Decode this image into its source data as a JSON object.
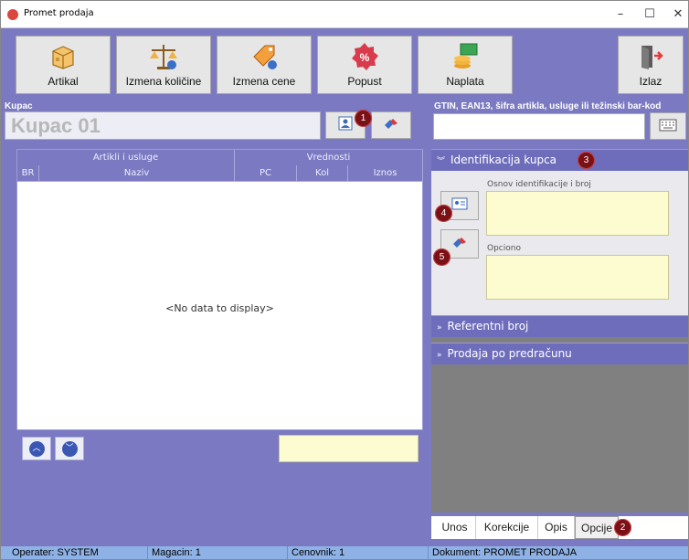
{
  "window": {
    "title": "Promet prodaja",
    "minimize": "–",
    "maximize": "☐",
    "close": "✕"
  },
  "toolbar": {
    "artikal": "Artikal",
    "izmena_kolicine": "Izmena količine",
    "izmena_cene": "Izmena cene",
    "popust": "Popust",
    "naplata": "Naplata",
    "izlaz": "Izlaz"
  },
  "kupac": {
    "label": "Kupac",
    "value": "Kupac 01"
  },
  "gtin": {
    "label": "GTIN, EAN13, šifra artikla, usluge ili težinski bar-kod",
    "value": ""
  },
  "grid": {
    "group_headers": [
      "Artikli i usluge",
      "Vrednosti"
    ],
    "columns": [
      "BR",
      "Naziv",
      "PC",
      "Kol",
      "Iznos"
    ],
    "empty_text": "<No data to display>"
  },
  "panel": {
    "identifikacija": "Identifikacija kupca",
    "osnov_label": "Osnov identifikacije i broj",
    "opciono_label": "Opciono",
    "referentni": "Referentni broj",
    "predracun": "Prodaja po predračunu"
  },
  "tabs": [
    "Unos",
    "Korekcije",
    "Opis",
    "Opcije"
  ],
  "badges": [
    "1",
    "2",
    "3",
    "4",
    "5"
  ],
  "status": {
    "operater": "Operater: SYSTEM",
    "magacin": "Magacin: 1",
    "cenovnik": "Cenovnik: 1",
    "dokument": "Dokument: PROMET PRODAJA"
  },
  "colors": {
    "window_bg": "#7a79c1",
    "panel_header": "#6e6dbb",
    "badge": "#7a1116",
    "yellow_field": "#fdfcd1",
    "status_bar": "#8fb2e6"
  },
  "icons": [
    "box-icon",
    "scale-icon",
    "price-tag-icon",
    "discount-icon",
    "coins-icon",
    "exit-door-icon",
    "contact-card-icon",
    "eraser-icon",
    "keyboard-icon",
    "arrow-up-icon",
    "arrow-down-icon",
    "chevron-down-icon",
    "chevron-right-icon"
  ]
}
